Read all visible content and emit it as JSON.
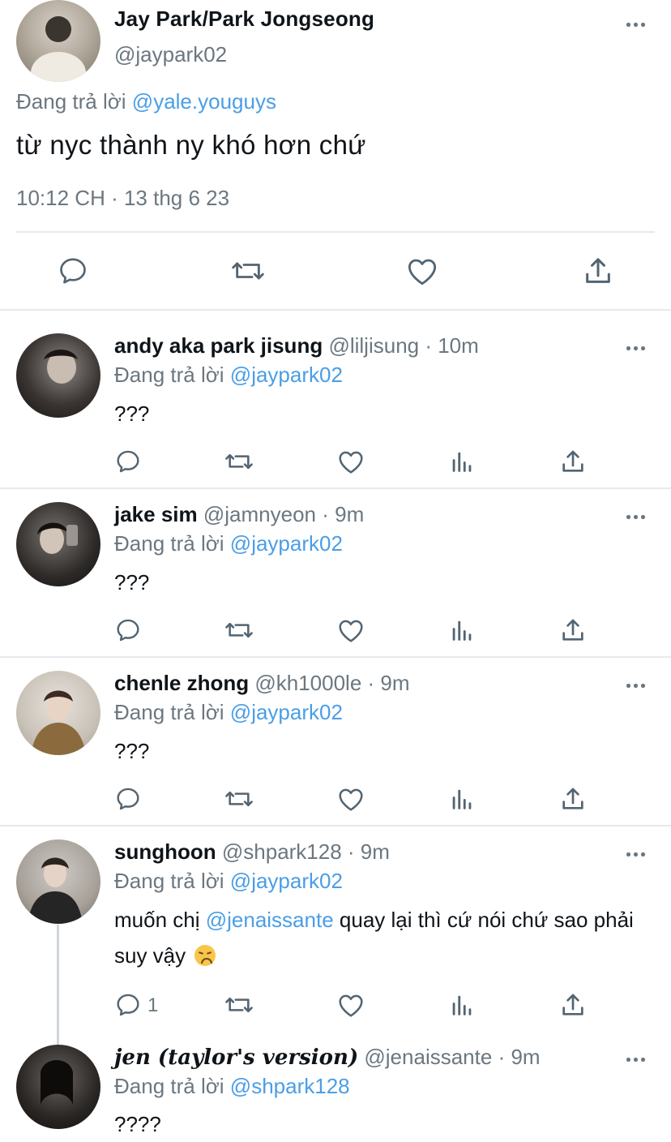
{
  "colors": {
    "link": "#4a9ee6",
    "muted": "#6b7780",
    "divider": "#e7e9ea"
  },
  "main_tweet": {
    "display_name": "Jay Park/Park Jongseong",
    "handle": "@jaypark02",
    "reply_prefix": "Đang trả lời",
    "reply_to": "@yale.youguys",
    "text": "từ nyc thành ny khó hơn chứ",
    "timestamp": "10:12 CH · 13 thg 6 23",
    "actions": [
      "reply-icon",
      "retweet-icon",
      "like-icon",
      "share-icon"
    ]
  },
  "replies": [
    {
      "display_name": "andy aka park jisung",
      "handle": "@liljisung",
      "time": "· 10m",
      "reply_prefix": "Đang trả lời",
      "reply_to": "@jaypark02",
      "text": "???",
      "reply_count": ""
    },
    {
      "display_name": "jake sim",
      "handle": "@jamnyeon",
      "time": "· 9m",
      "reply_prefix": "Đang trả lời",
      "reply_to": "@jaypark02",
      "text": "???",
      "reply_count": ""
    },
    {
      "display_name": "chenle zhong",
      "handle": "@kh1000le",
      "time": "· 9m",
      "reply_prefix": "Đang trả lời",
      "reply_to": "@jaypark02",
      "text": "???",
      "reply_count": ""
    },
    {
      "display_name": "sunghoon",
      "handle": "@shpark128",
      "time": "· 9m",
      "reply_prefix": "Đang trả lời",
      "reply_to": "@jaypark02",
      "text_before": "muốn chị",
      "mention": "@jenaissante",
      "text_after": "quay lại thì cứ nói chứ sao phải suy vậy",
      "emoji": "disappointed-face-emoji",
      "reply_count": "1"
    },
    {
      "display_name": "jen (taylor's version)",
      "handle": "@jenaissante",
      "time": "· 9m",
      "reply_prefix": "Đang trả lời",
      "reply_to": "@shpark128",
      "text": "????"
    }
  ]
}
